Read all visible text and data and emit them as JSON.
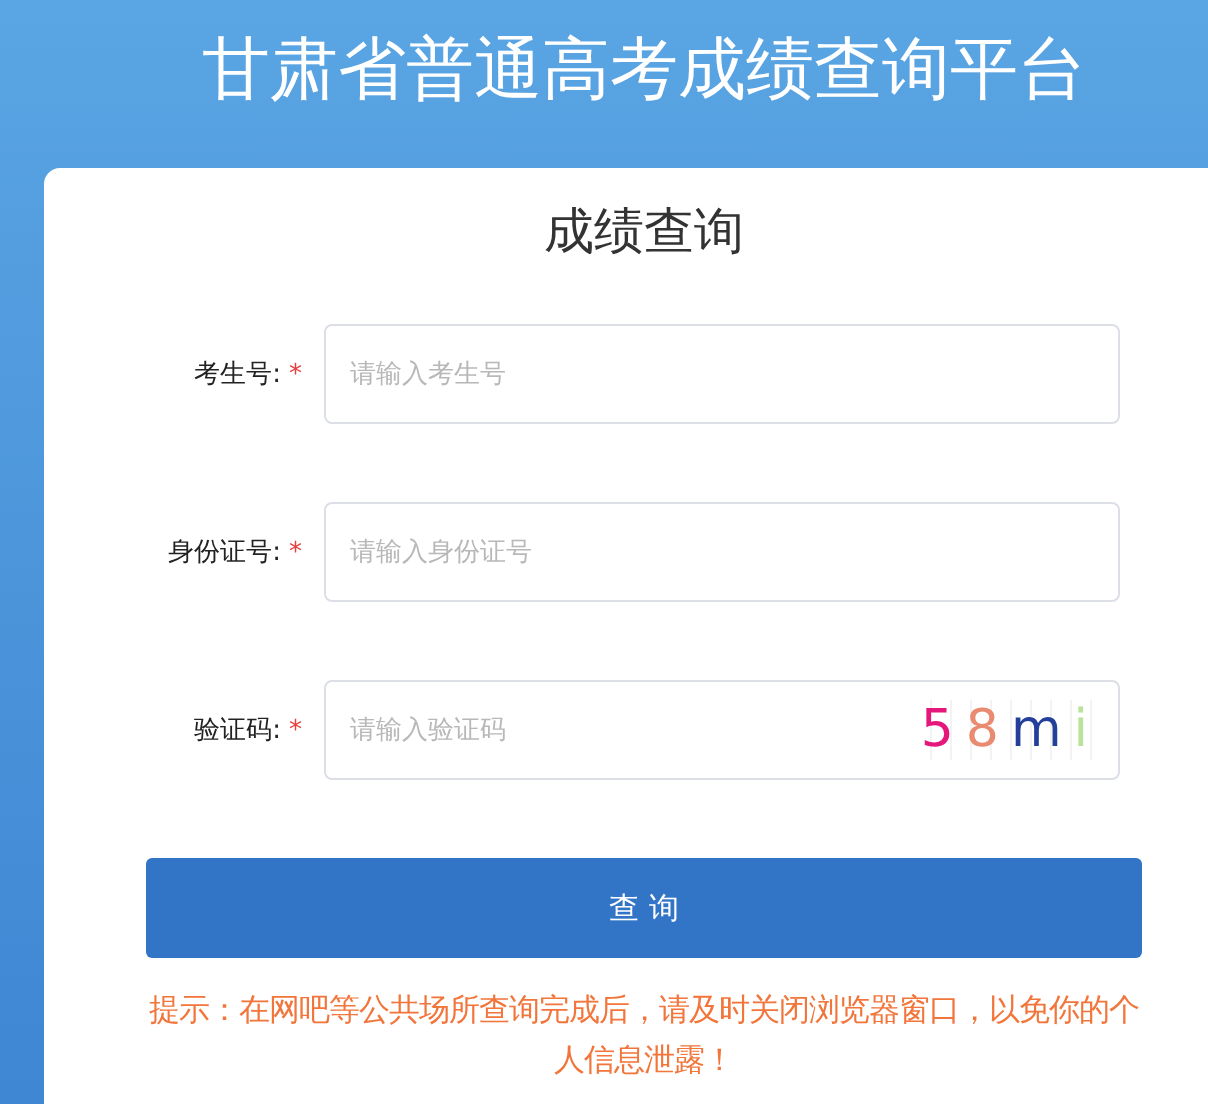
{
  "page_title": "甘肃省普通高考成绩查询平台",
  "form": {
    "title": "成绩查询",
    "required_mark": "*",
    "fields": [
      {
        "kind": "text",
        "label": "考生号:",
        "required": true,
        "placeholder": "请输入考生号"
      },
      {
        "kind": "text",
        "label": "身份证号:",
        "required": true,
        "placeholder": "请输入身份证号"
      },
      {
        "kind": "captcha",
        "label": "验证码:",
        "required": true,
        "placeholder": "请输入验证码",
        "captcha": [
          {
            "char": "5",
            "color": "#e5177b"
          },
          {
            "char": "8",
            "color": "#ea8a70"
          },
          {
            "char": "m",
            "color": "#233f9a"
          },
          {
            "char": "i",
            "color": "#b9e29a"
          }
        ]
      }
    ],
    "submit": "查 询",
    "tip": "提示：在网吧等公共场所查询完成后，请及时关闭浏览器窗口，以免你的个人信息泄露！"
  }
}
